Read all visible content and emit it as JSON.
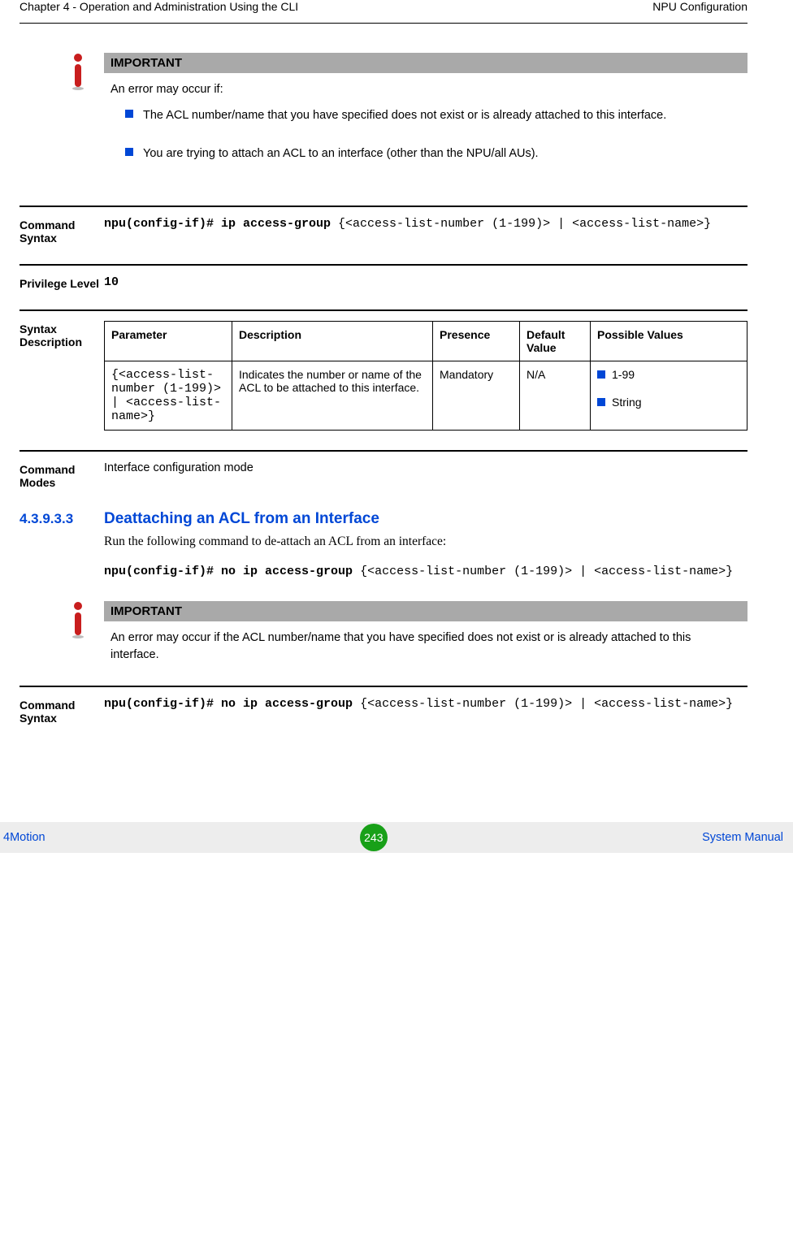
{
  "header": {
    "left": "Chapter 4 - Operation and Administration Using the CLI",
    "right": "NPU Configuration"
  },
  "imp1": {
    "label": "IMPORTANT",
    "intro": "An error may occur if:",
    "bullets": [
      "The ACL number/name that you have specified does not exist or is already attached to this interface.",
      "You are trying to attach an ACL to an interface (other than the NPU/all AUs)."
    ]
  },
  "cmdSyntax1": {
    "label": "Command Syntax",
    "bold": "npu(config-if)# ip access-group",
    "rest": " {<access-list-number (1-199)> | <access-list-name>}"
  },
  "privLevel": {
    "label": "Privilege Level",
    "value": "10"
  },
  "syntaxDesc": {
    "label": "Syntax Description",
    "headers": {
      "param": "Parameter",
      "desc": "Description",
      "pres": "Presence",
      "def": "Default Value",
      "poss": "Possible Values"
    },
    "row": {
      "param": "{<access-list-number (1-199)> | <access-list-name>}",
      "desc": "Indicates the number or name of the ACL to be attached to this interface.",
      "pres": "Mandatory",
      "def": "N/A",
      "poss": [
        "1-99",
        "String"
      ]
    }
  },
  "cmdModes": {
    "label": "Command Modes",
    "value": "Interface configuration mode"
  },
  "section": {
    "num": "4.3.9.3.3",
    "title": "Deattaching an ACL from an Interface",
    "intro": "Run the following command to de-attach an ACL from an interface:",
    "codeBold": "npu(config-if)# no ip access-group",
    "codeRest": " {<access-list-number (1-199)> | <access-list-name>}"
  },
  "imp2": {
    "label": "IMPORTANT",
    "text": "An error may occur if the ACL number/name that you have specified does not exist or is already attached to this interface."
  },
  "cmdSyntax2": {
    "label": "Command Syntax",
    "bold": "npu(config-if)# no ip access-group",
    "rest": " {<access-list-number (1-199)> | <access-list-name>}"
  },
  "footer": {
    "left": "4Motion",
    "page": "243",
    "right": "System Manual"
  }
}
